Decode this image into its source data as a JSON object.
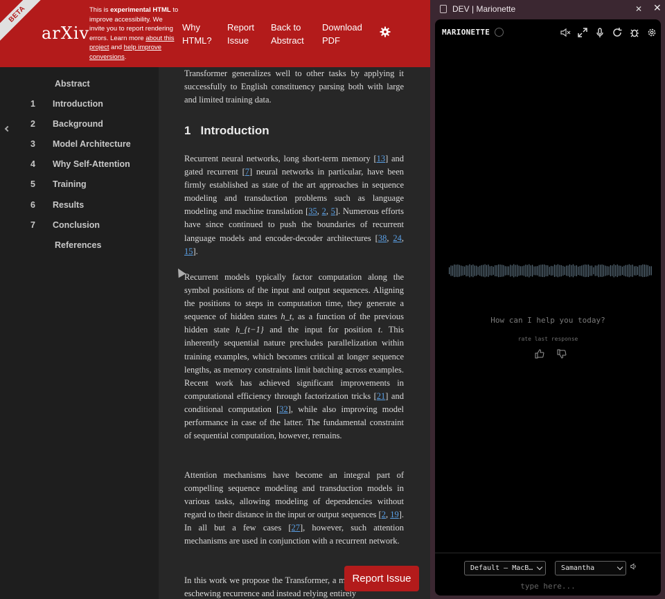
{
  "arxiv": {
    "beta_label": "BETA",
    "logo_text": "arXiv",
    "notice": {
      "pre": "This is ",
      "bold": "experimental HTML",
      "mid": " to improve accessibility. We invite you to report rendering errors. Learn more ",
      "link1": "about this project",
      "and": " and ",
      "link2": "help improve conversions",
      "end": "."
    },
    "nav": {
      "why_html": "Why HTML?",
      "report_issue": "Report Issue",
      "back_to_abstract": "Back to Abstract",
      "download_pdf": "Download PDF"
    },
    "toc": [
      {
        "num": "",
        "label": "Abstract"
      },
      {
        "num": "1",
        "label": "Introduction"
      },
      {
        "num": "2",
        "label": "Background"
      },
      {
        "num": "3",
        "label": "Model Architecture"
      },
      {
        "num": "4",
        "label": "Why Self-Attention"
      },
      {
        "num": "5",
        "label": "Training"
      },
      {
        "num": "6",
        "label": "Results"
      },
      {
        "num": "7",
        "label": "Conclusion"
      },
      {
        "num": "",
        "label": "References"
      }
    ],
    "content": {
      "p0": "Transformer generalizes well to other tasks by applying it successfully to English constituency parsing both with large and limited training data.",
      "section_num": "1",
      "section_title": "Introduction",
      "p1": [
        "Recurrent neural networks, long short-term memory [",
        "13",
        "] and gated recurrent [",
        "7",
        "] neural networks in particular, have been firmly established as state of the art approaches in sequence modeling and transduction problems such as language modeling and machine translation [",
        "35",
        ", ",
        "2",
        ", ",
        "5",
        "]. Numerous efforts have since continued to push the boundaries of recurrent language models and encoder-decoder architectures [",
        "38",
        ", ",
        "24",
        ", ",
        "15",
        "]."
      ],
      "p2": [
        "Recurrent models typically factor computation along the symbol positions of the input and output sequences. Aligning the positions to steps in computation time, they generate a sequence of hidden states ",
        "h_t",
        ", as a function of the previous hidden state ",
        "h_{t−1}",
        " and the input for position ",
        "t",
        ". This inherently sequential nature precludes parallelization within training examples, which becomes critical at longer sequence lengths, as memory constraints limit batching across examples. Recent work has achieved significant improvements in computational efficiency through factorization tricks [",
        "21",
        "] and conditional computation [",
        "32",
        "], while also improving model performance in case of the latter. The fundamental constraint of sequential computation, however, remains."
      ],
      "p3": [
        "Attention mechanisms have become an integral part of compelling sequence modeling and transduction models in various tasks, allowing modeling of dependencies without regard to their distance in the input or output sequences [",
        "2",
        ", ",
        "19",
        "]. In all but a few cases [",
        "27",
        "], however, such attention mechanisms are used in conjunction with a recurrent network."
      ],
      "p4": "In this work we propose the Transformer, a model architecture eschewing recurrence and instead relying entirely"
    },
    "report_button": "Report Issue"
  },
  "marionette": {
    "window_title": "DEV | Marionette",
    "app_name": "MARIONETTE",
    "greeting": "How can I help you today?",
    "rate_label": "rate last response",
    "voice_select": "Default – MacB…",
    "voice_name": "Samantha",
    "input_placeholder": "type here..."
  }
}
